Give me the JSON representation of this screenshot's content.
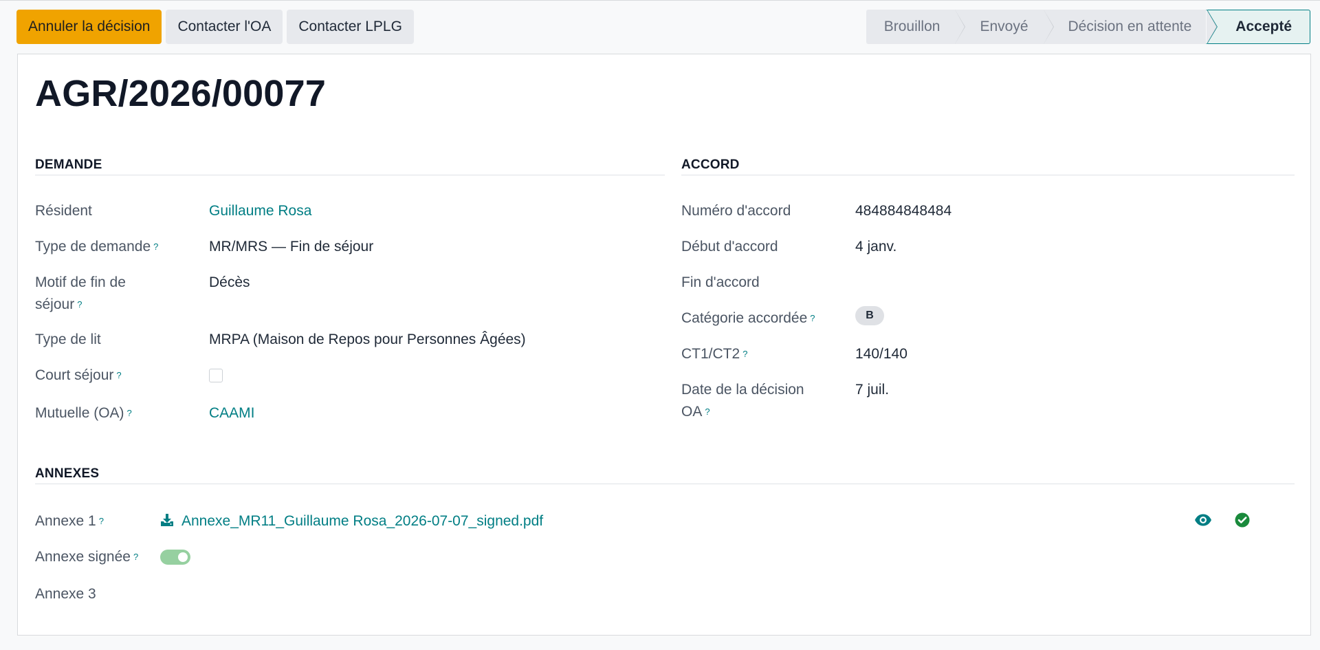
{
  "actions": {
    "cancel_decision": "Annuler la décision",
    "contact_oa": "Contacter l'OA",
    "contact_lplg": "Contacter LPLG"
  },
  "status": {
    "stages": [
      "Brouillon",
      "Envoyé",
      "Décision en attente",
      "Accepté"
    ],
    "active": "Accepté"
  },
  "record": {
    "title": "AGR/2026/00077"
  },
  "demande": {
    "heading": "DEMANDE",
    "resident_label": "Résident",
    "resident_value": "Guillaume Rosa",
    "type_label": "Type de demande",
    "type_value": "MR/MRS — Fin de séjour",
    "motif_label_1": "Motif de fin de",
    "motif_label_2": "séjour",
    "motif_value": "Décès",
    "lit_label": "Type de lit",
    "lit_value": "MRPA (Maison de Repos pour Personnes Âgées)",
    "court_label": "Court séjour",
    "court_checked": false,
    "mutuelle_label": "Mutuelle (OA)",
    "mutuelle_value": "CAAMI"
  },
  "accord": {
    "heading": "ACCORD",
    "numero_label": "Numéro d'accord",
    "numero_value": "484884848484",
    "debut_label": "Début d'accord",
    "debut_value": "4 janv.",
    "fin_label": "Fin d'accord",
    "fin_value": "",
    "categorie_label": "Catégorie accordée",
    "categorie_value": "B",
    "ct_label": "CT1/CT2",
    "ct_value": "140/140",
    "date_label_1": "Date de la décision",
    "date_label_2": "OA",
    "date_value": "7 juil."
  },
  "annexes": {
    "heading": "ANNEXES",
    "annexe1_label": "Annexe 1",
    "annexe1_file": "Annexe_MR11_Guillaume Rosa_2026-07-07_signed.pdf",
    "signee_label": "Annexe signée",
    "signee_on": true,
    "annexe3_label": "Annexe 3"
  },
  "help_mark": "?",
  "colors": {
    "primary": "#f0a300",
    "link": "#017e84",
    "success": "#1a8a3c",
    "toggle_on": "#96d0a0"
  },
  "icons": [
    "download-icon",
    "eye-icon",
    "check-circle-icon"
  ]
}
